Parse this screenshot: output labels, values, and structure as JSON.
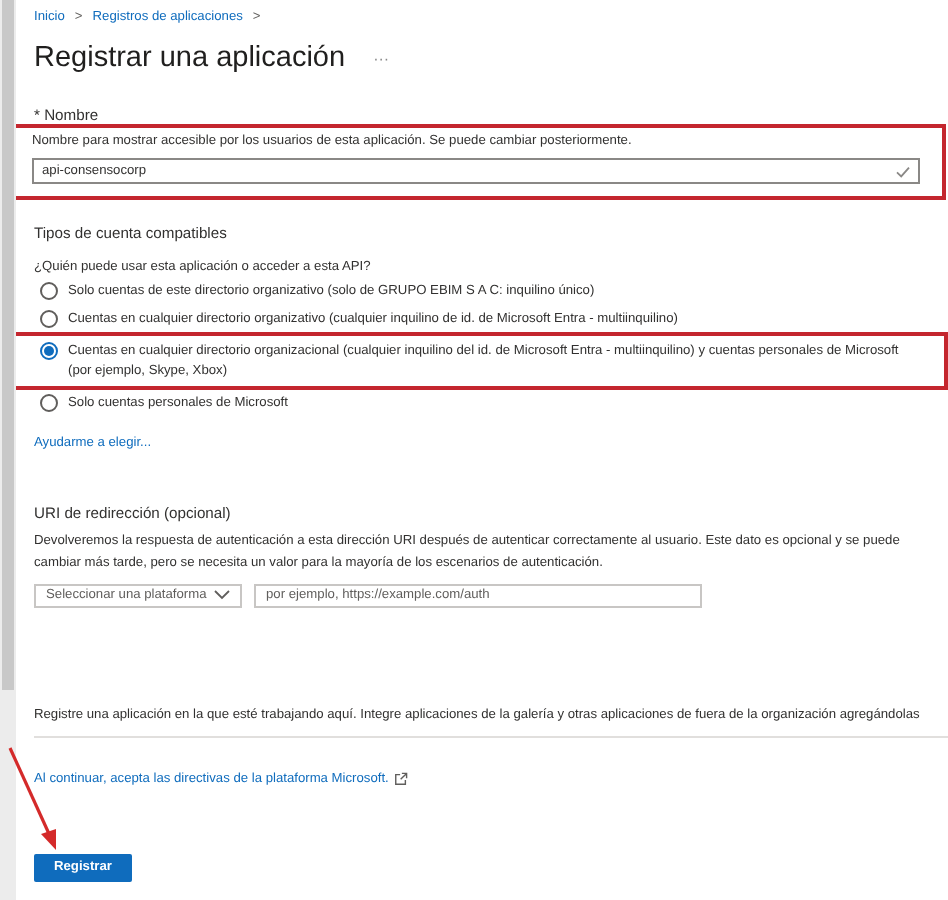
{
  "breadcrumb": {
    "separator": ">",
    "items": [
      {
        "label": "Inicio"
      },
      {
        "label": "Registros de aplicaciones"
      }
    ]
  },
  "title": "Registrar una aplicación",
  "more": "···",
  "name_section": {
    "label": "* Nombre",
    "help": "Nombre para mostrar accesible por los usuarios de esta aplicación. Se puede cambiar posteriormente.",
    "value": "api-consensocorp",
    "valid": true,
    "highlighted": true
  },
  "account_types": {
    "heading": "Tipos de cuenta compatibles",
    "question": "¿Quién puede usar esta aplicación o acceder a esta API?",
    "options": [
      {
        "label": "Solo cuentas de este directorio organizativo (solo de GRUPO EBIM S A C: inquilino único)",
        "selected": false,
        "highlighted": false
      },
      {
        "label": "Cuentas en cualquier directorio organizativo (cualquier inquilino de id. de Microsoft Entra - multiinquilino)",
        "selected": false,
        "highlighted": false
      },
      {
        "label": "Cuentas en cualquier directorio organizacional (cualquier inquilino del id. de Microsoft Entra - multiinquilino) y cuentas personales de Microsoft (por ejemplo, Skype, Xbox)",
        "selected": true,
        "highlighted": true
      },
      {
        "label": "Solo cuentas personales de Microsoft",
        "selected": false,
        "highlighted": false
      }
    ],
    "help_link": "Ayudarme a elegir..."
  },
  "redirect": {
    "heading": "URI de redirección (opcional)",
    "description": "Devolveremos la respuesta de autenticación a esta dirección URI después de autenticar correctamente al usuario. Este dato es opcional y se puede cambiar más tarde, pero se necesita un valor para la mayoría de los escenarios de autenticación.",
    "platform": {
      "placeholder": "Seleccionar una plataforma"
    },
    "uri": {
      "placeholder": "por ejemplo, https://example.com/auth"
    }
  },
  "footer": {
    "note": "Registre una aplicación en la que esté trabajando aquí. Integre aplicaciones de la galería y otras aplicaciones de fuera de la organización agregándolas",
    "policy_link": "Al continuar, acepta las directivas de la plataforma Microsoft.",
    "button": "Registrar"
  }
}
